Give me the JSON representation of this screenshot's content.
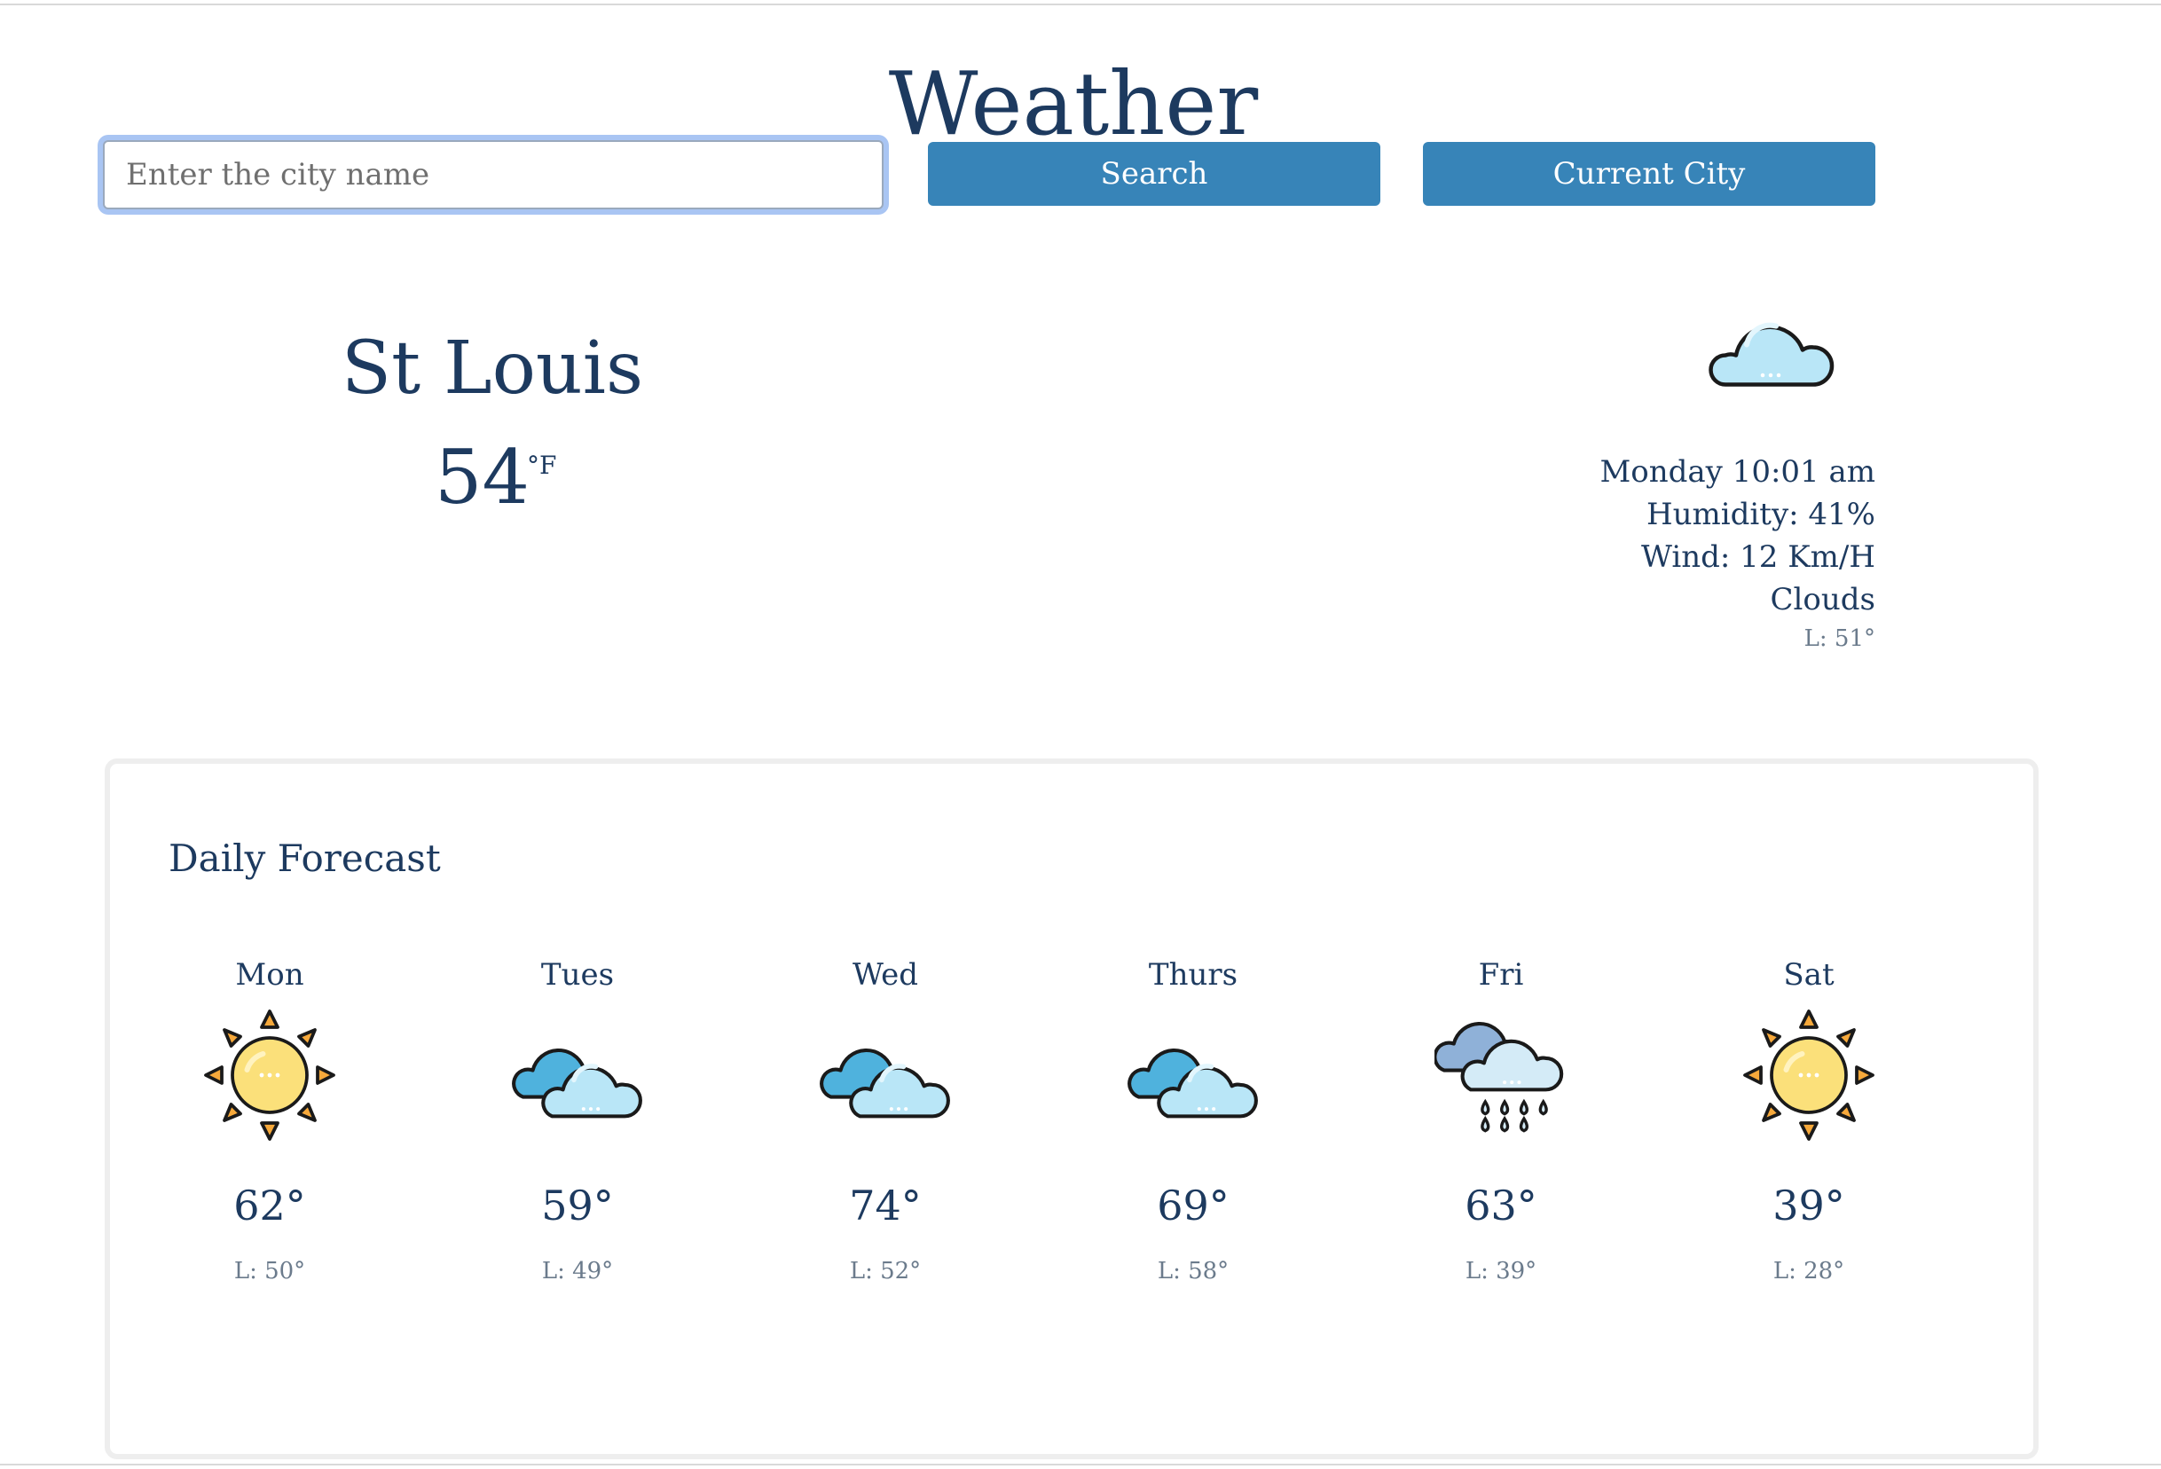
{
  "app": {
    "title": "Weather"
  },
  "search": {
    "placeholder": "Enter the city name",
    "value": ""
  },
  "buttons": {
    "search_label": "Search",
    "current_city_label": "Current City"
  },
  "current": {
    "city": "St Louis",
    "temperature": "54",
    "unit": "°F",
    "icon": "cloud-icon",
    "datetime": "Monday 10:01 am",
    "humidity": "Humidity: 41%",
    "wind": "Wind: 12 Km/H",
    "condition": "Clouds",
    "low": "L: 51°"
  },
  "forecast": {
    "title": "Daily Forecast",
    "days": [
      {
        "name": "Mon",
        "icon": "sun-icon",
        "high": "62°",
        "low": "L: 50°"
      },
      {
        "name": "Tues",
        "icon": "clouds-icon",
        "high": "59°",
        "low": "L: 49°"
      },
      {
        "name": "Wed",
        "icon": "clouds-icon",
        "high": "74°",
        "low": "L: 52°"
      },
      {
        "name": "Thurs",
        "icon": "clouds-icon",
        "high": "69°",
        "low": "L: 58°"
      },
      {
        "name": "Fri",
        "icon": "rain-icon",
        "high": "63°",
        "low": "L: 39°"
      },
      {
        "name": "Sat",
        "icon": "sun-icon",
        "high": "39°",
        "low": "L: 28°"
      }
    ]
  },
  "colors": {
    "primary_text": "#1d3a5f",
    "button": "#3784b8",
    "muted_text": "#6b7b8c"
  }
}
